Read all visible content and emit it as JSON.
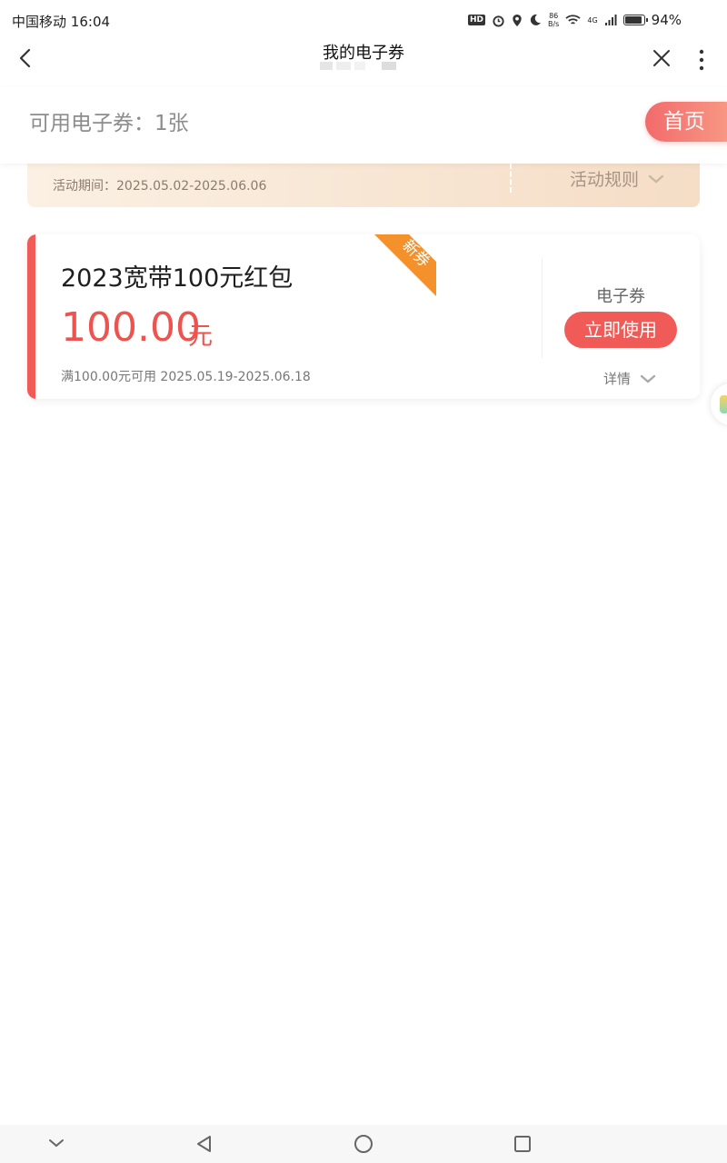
{
  "status_bar": {
    "carrier": "中国移动",
    "time": "16:04",
    "hd": "HD",
    "net_speed_value": "86",
    "net_speed_unit": "B/s",
    "signal_type": "4G",
    "battery_percent": "94%",
    "battery_level": 0.94
  },
  "nav": {
    "title": "我的电子券"
  },
  "summary": {
    "count_text": "可用电子券：1张",
    "home_button": "首页"
  },
  "banner": {
    "period": "活动期间：2025.05.02-2025.06.06",
    "rules_label": "活动规则"
  },
  "coupon": {
    "name": "2023宽带100元红包",
    "amount": "100.00",
    "unit": "元",
    "condition": "满100.00元可用 2025.05.19-2025.06.18",
    "tag": "新券",
    "type": "电子券",
    "use_button": "立即使用",
    "detail_label": "详情"
  },
  "colors": {
    "accent_red": "#f15b57",
    "tag_orange": "#f5912a",
    "banner_bg": "#f5ddc6"
  },
  "icons": {
    "back": "chevron-left-icon",
    "close": "close-icon",
    "more": "more-vertical-icon",
    "expand": "chevron-down-icon",
    "system_back": "triangle-back-icon",
    "system_home": "circle-home-icon",
    "system_recents": "square-recents-icon",
    "system_collapse": "chevron-down-icon"
  }
}
